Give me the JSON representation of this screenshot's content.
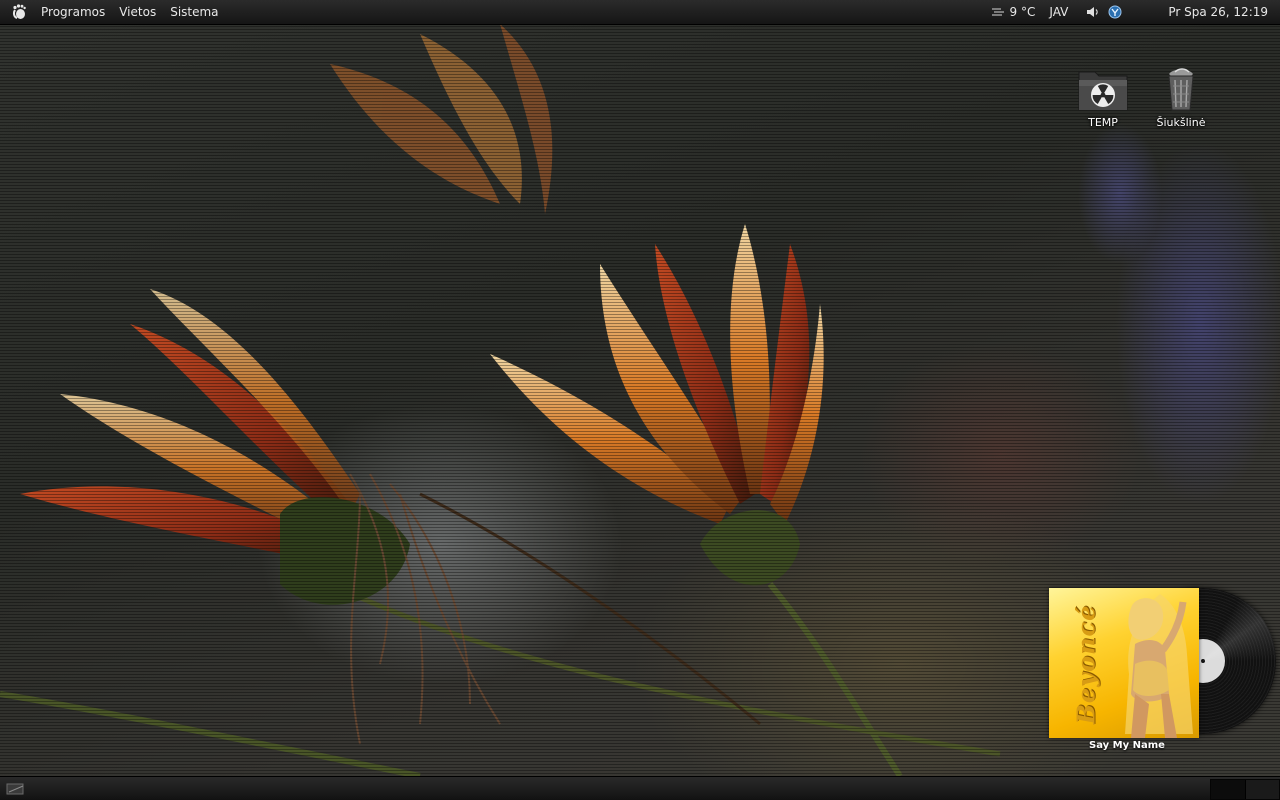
{
  "top_panel": {
    "menus": [
      {
        "label": "Programos"
      },
      {
        "label": "Vietos"
      },
      {
        "label": "Sistema"
      }
    ],
    "weather": "9 °C",
    "keyboard_layout": "JAV",
    "clock": "Pr Spa 26, 12:19"
  },
  "desktop": {
    "icons": [
      {
        "label": "TEMP",
        "icon": "folder-radiation-icon"
      },
      {
        "label": "Šiukšlinė",
        "icon": "trash-icon"
      }
    ]
  },
  "music_widget": {
    "song_title": "Say My Name",
    "cover_artist": "Beyoncé"
  },
  "bottom_panel": {
    "workspaces": 2,
    "active_workspace": 1
  },
  "colors": {
    "panel_bg": "#1a1a1a",
    "panel_text": "#e8e8e8",
    "cover_yellow": "#ffd230"
  }
}
